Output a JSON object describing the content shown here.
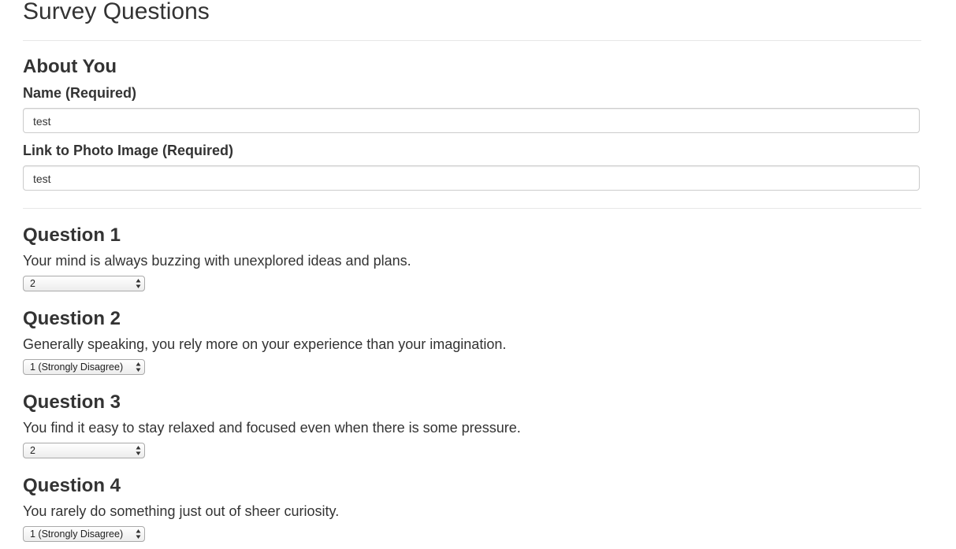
{
  "page_title": "Survey Questions",
  "about": {
    "heading": "About You",
    "name_label": "Name (Required)",
    "name_value": "test",
    "photo_label": "Link to Photo Image (Required)",
    "photo_value": "test"
  },
  "questions": [
    {
      "heading": "Question 1",
      "text": "Your mind is always buzzing with unexplored ideas and plans.",
      "selected": "2"
    },
    {
      "heading": "Question 2",
      "text": "Generally speaking, you rely more on your experience than your imagination.",
      "selected": "1 (Strongly Disagree)"
    },
    {
      "heading": "Question 3",
      "text": "You find it easy to stay relaxed and focused even when there is some pressure.",
      "selected": "2"
    },
    {
      "heading": "Question 4",
      "text": "You rarely do something just out of sheer curiosity.",
      "selected": "1 (Strongly Disagree)"
    }
  ]
}
